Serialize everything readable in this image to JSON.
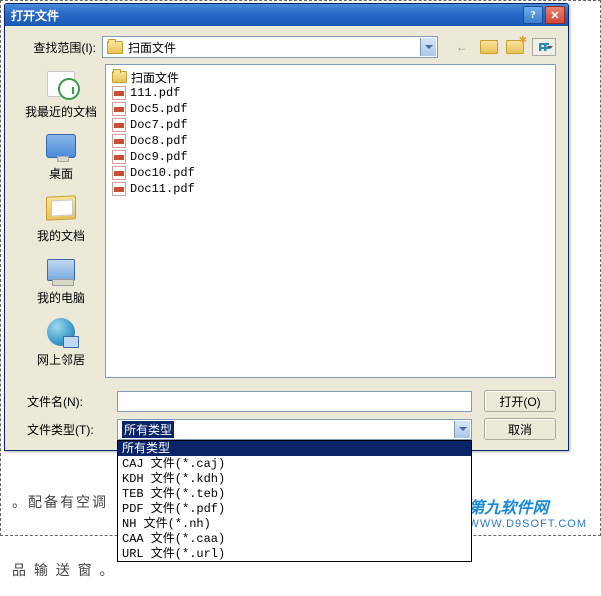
{
  "title": "打开文件",
  "lookin": {
    "label": "查找范围(I):",
    "value": "扫面文件"
  },
  "places": {
    "recent": "我最近的文档",
    "desktop": "桌面",
    "docs": "我的文档",
    "computer": "我的电脑",
    "network": "网上邻居"
  },
  "files": [
    {
      "type": "folder",
      "name": "扫面文件"
    },
    {
      "type": "pdf",
      "name": "111.pdf"
    },
    {
      "type": "pdf",
      "name": "Doc5.pdf"
    },
    {
      "type": "pdf",
      "name": "Doc7.pdf"
    },
    {
      "type": "pdf",
      "name": "Doc8.pdf"
    },
    {
      "type": "pdf",
      "name": "Doc9.pdf"
    },
    {
      "type": "pdf",
      "name": "Doc10.pdf"
    },
    {
      "type": "pdf",
      "name": "Doc11.pdf"
    }
  ],
  "filename": {
    "label": "文件名(N):",
    "value": ""
  },
  "filetype": {
    "label": "文件类型(T):",
    "value": "所有类型"
  },
  "buttons": {
    "open": "打开(O)",
    "cancel": "取消"
  },
  "typeOptions": [
    "所有类型",
    "CAJ 文件(*.caj)",
    "KDH 文件(*.kdh)",
    "TEB 文件(*.teb)",
    "PDF 文件(*.pdf)",
    "NH 文件(*.nh)",
    "CAA 文件(*.caa)",
    "URL 文件(*.url)"
  ],
  "bg": {
    "line1": "。配备有空调（或降温                      用 工 具 ，并 设",
    "line2": "品 输 送 窗 。"
  },
  "watermark": {
    "main": "第九软件网",
    "sub": "WWW.D9SOFT.COM"
  }
}
